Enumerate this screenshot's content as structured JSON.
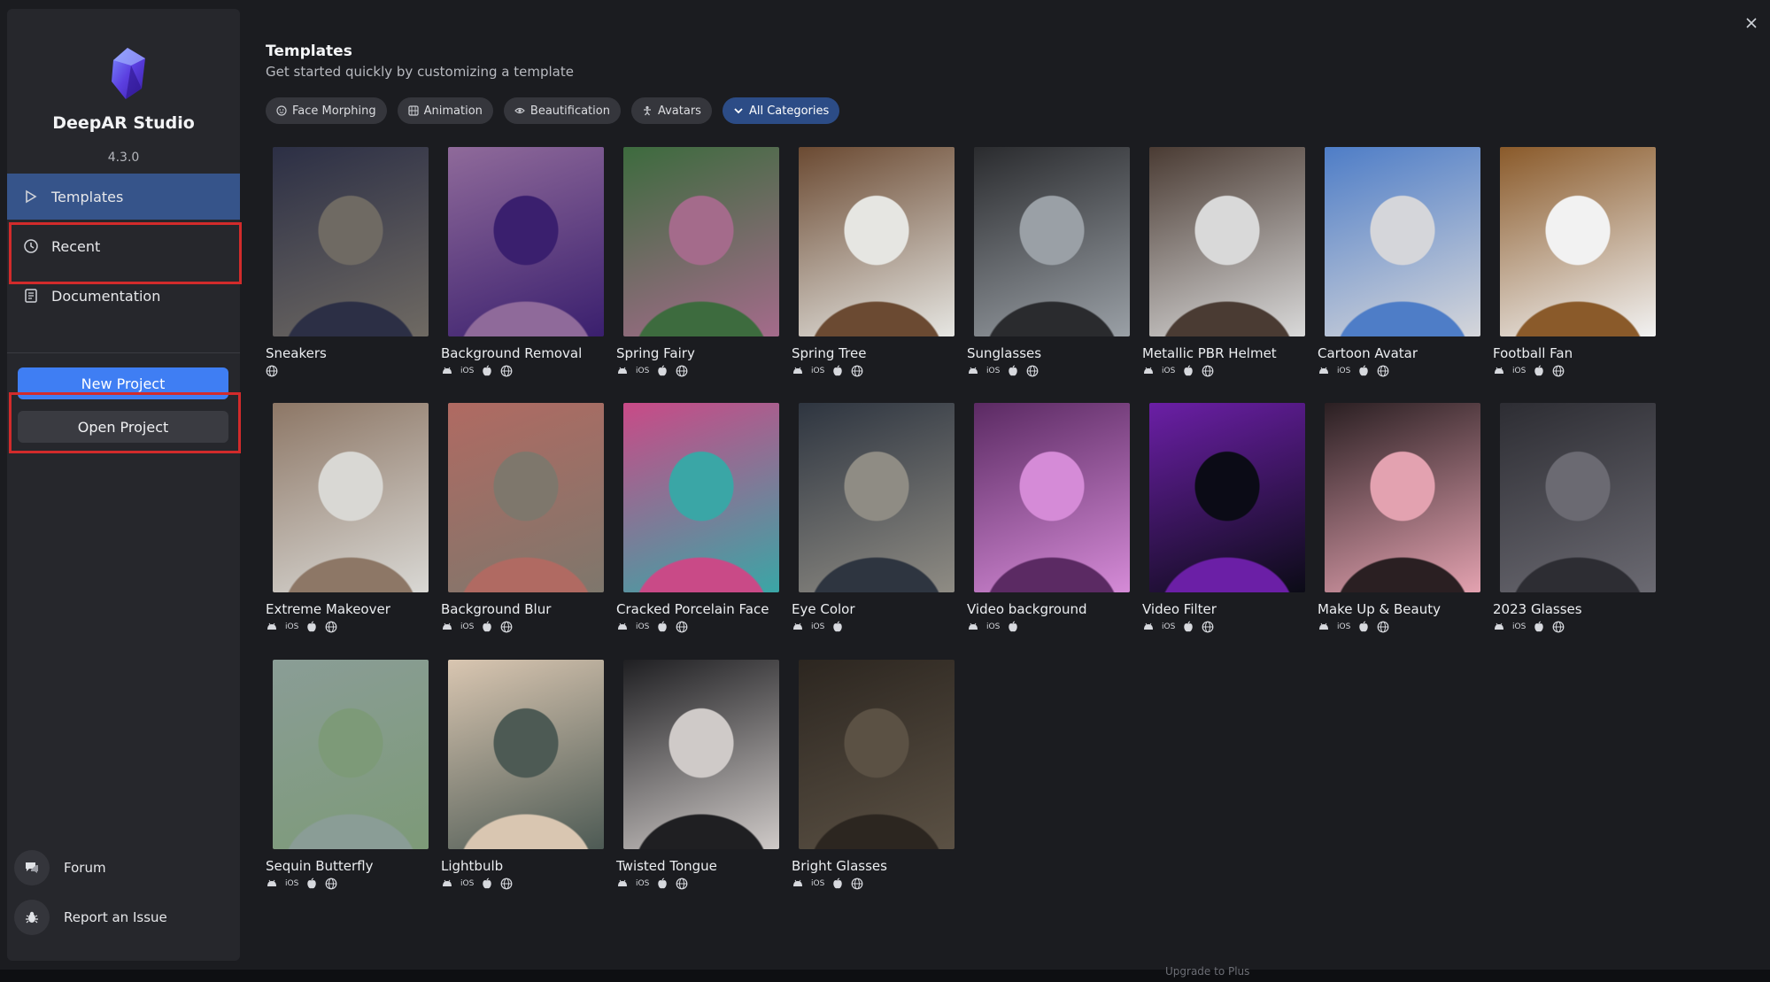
{
  "app": {
    "name": "DeepAR Studio",
    "version": "4.3.0"
  },
  "nav": [
    {
      "label": "Templates",
      "icon": "play-icon",
      "active": true
    },
    {
      "label": "Recent",
      "icon": "clock-icon",
      "active": false
    },
    {
      "label": "Documentation",
      "icon": "document-icon",
      "active": false
    }
  ],
  "buttons": {
    "new_project": "New Project",
    "open_project": "Open Project"
  },
  "footer": {
    "forum": "Forum",
    "report": "Report an Issue"
  },
  "header": {
    "title": "Templates",
    "subtitle": "Get started quickly by customizing a template"
  },
  "filters": [
    {
      "label": "Face Morphing",
      "icon": "face-icon"
    },
    {
      "label": "Animation",
      "icon": "animation-icon"
    },
    {
      "label": "Beautification",
      "icon": "eye-icon"
    },
    {
      "label": "Avatars",
      "icon": "person-icon"
    },
    {
      "label": "All Categories",
      "icon": "chevron-down-icon",
      "active": true
    }
  ],
  "templates": [
    {
      "name": "Sneakers",
      "platforms": [
        "web"
      ],
      "colors": [
        "#6f6a63",
        "#2c2f45"
      ]
    },
    {
      "name": "Background Removal",
      "platforms": [
        "android",
        "ios",
        "apple",
        "web"
      ],
      "colors": [
        "#3a1f6e",
        "#8f6a9a"
      ]
    },
    {
      "name": "Spring Fairy",
      "platforms": [
        "android",
        "ios",
        "apple",
        "web"
      ],
      "colors": [
        "#a46b8b",
        "#3d6b3e"
      ]
    },
    {
      "name": "Spring Tree",
      "platforms": [
        "android",
        "ios",
        "apple",
        "web"
      ],
      "colors": [
        "#e6e6e2",
        "#6b4a32"
      ]
    },
    {
      "name": "Sunglasses",
      "platforms": [
        "android",
        "ios",
        "apple",
        "web"
      ],
      "colors": [
        "#9aa0a6",
        "#2a2b2e"
      ]
    },
    {
      "name": "Metallic PBR Helmet",
      "platforms": [
        "android",
        "ios",
        "apple",
        "web"
      ],
      "colors": [
        "#d9d9d9",
        "#4a3b33"
      ]
    },
    {
      "name": "Cartoon Avatar",
      "platforms": [
        "android",
        "ios",
        "apple",
        "web"
      ],
      "colors": [
        "#d5d6da",
        "#4e7dc7"
      ]
    },
    {
      "name": "Football Fan",
      "platforms": [
        "android",
        "ios",
        "apple",
        "web"
      ],
      "colors": [
        "#f2f2f2",
        "#8a5a2a"
      ]
    },
    {
      "name": "Extreme Makeover",
      "platforms": [
        "android",
        "ios",
        "apple",
        "web"
      ],
      "colors": [
        "#d9d8d4",
        "#8d7766"
      ]
    },
    {
      "name": "Background Blur",
      "platforms": [
        "android",
        "ios",
        "apple",
        "web"
      ],
      "colors": [
        "#7e776c",
        "#b06a62"
      ]
    },
    {
      "name": "Cracked Porcelain Face",
      "platforms": [
        "android",
        "ios",
        "apple",
        "web"
      ],
      "colors": [
        "#3aa6a6",
        "#c94a87"
      ]
    },
    {
      "name": "Eye Color",
      "platforms": [
        "android",
        "ios",
        "apple"
      ],
      "colors": [
        "#8f8c84",
        "#2e3540"
      ]
    },
    {
      "name": "Video background",
      "platforms": [
        "android",
        "ios",
        "apple"
      ],
      "colors": [
        "#d58bd7",
        "#5b2a63"
      ]
    },
    {
      "name": "Video Filter",
      "platforms": [
        "android",
        "ios",
        "apple",
        "web"
      ],
      "colors": [
        "#0b0b16",
        "#6b1fa6"
      ]
    },
    {
      "name": "Make Up & Beauty",
      "platforms": [
        "android",
        "ios",
        "apple",
        "web"
      ],
      "colors": [
        "#e3a2b0",
        "#2a1f22"
      ]
    },
    {
      "name": "2023 Glasses",
      "platforms": [
        "android",
        "ios",
        "apple",
        "web"
      ],
      "colors": [
        "#6b6a72",
        "#2d2d33"
      ]
    },
    {
      "name": "Sequin Butterfly",
      "platforms": [
        "android",
        "ios",
        "apple",
        "web"
      ],
      "colors": [
        "#7d9a78",
        "#8a9d96"
      ]
    },
    {
      "name": "Lightbulb",
      "platforms": [
        "android",
        "ios",
        "apple",
        "web"
      ],
      "colors": [
        "#4d5a54",
        "#d9c6b1"
      ]
    },
    {
      "name": "Twisted Tongue",
      "platforms": [
        "android",
        "ios",
        "apple",
        "web"
      ],
      "colors": [
        "#cfcac8",
        "#1f1f22"
      ]
    },
    {
      "name": "Bright Glasses",
      "platforms": [
        "android",
        "ios",
        "apple",
        "web"
      ],
      "colors": [
        "#5b5144",
        "#2c2620"
      ]
    }
  ],
  "platform_labels": {
    "ios": "iOS"
  },
  "bottom": {
    "upgrade": "Upgrade to Plus"
  },
  "theme": {
    "accent": "#3f7ef3",
    "highlight": "#d22b2b",
    "sidebar": "#26272c",
    "background": "#1b1c20"
  }
}
